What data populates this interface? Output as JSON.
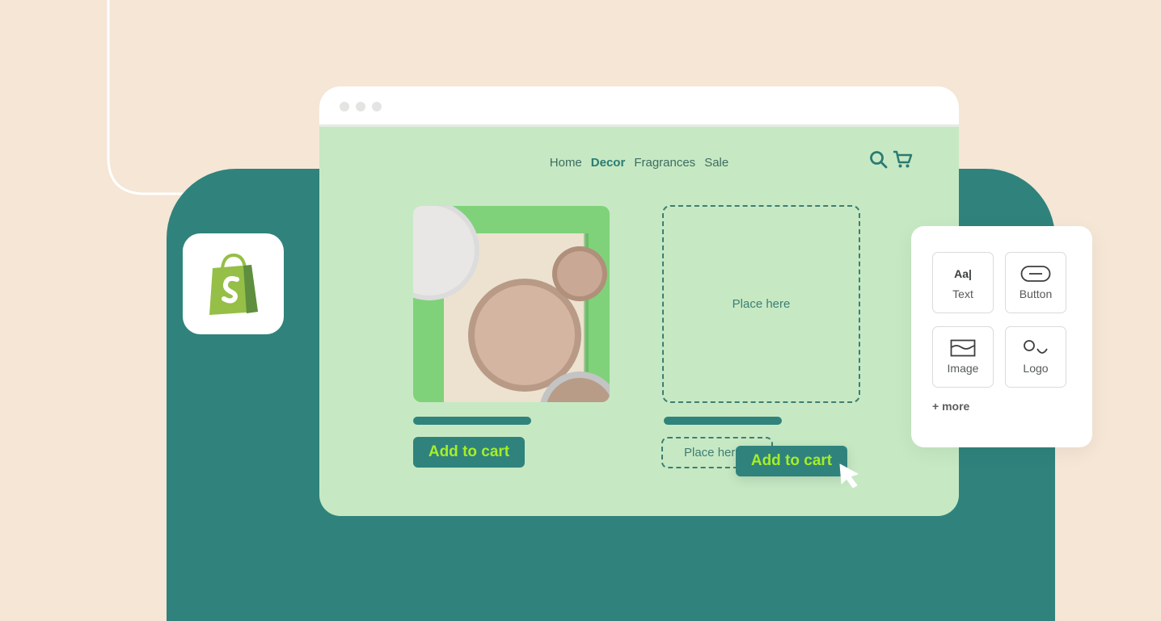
{
  "colors": {
    "background": "#f5e6d6",
    "teal": "#2f837c",
    "storefront": "#c6e9c3",
    "button_text": "#a6ee28",
    "shopify_green": "#95bf47"
  },
  "app_icon": {
    "icon": "shopify-bag-icon"
  },
  "browser": {
    "nav": {
      "items": [
        "Home",
        "Decor",
        "Fragrances",
        "Sale"
      ],
      "active": "Decor"
    },
    "icons": [
      "search-icon",
      "cart-icon"
    ],
    "product": {
      "button_label": "Add to cart"
    },
    "placeholder": {
      "image_label": "Place here",
      "button_label": "Place here"
    },
    "dragged_button_label": "Add to cart"
  },
  "panel": {
    "tiles": [
      {
        "label": "Text",
        "icon": "text-aa-icon",
        "glyph": "Aa|"
      },
      {
        "label": "Button",
        "icon": "button-pill-icon"
      },
      {
        "label": "Image",
        "icon": "image-icon"
      },
      {
        "label": "Logo",
        "icon": "logo-icon"
      }
    ],
    "more_label": "+ more"
  }
}
